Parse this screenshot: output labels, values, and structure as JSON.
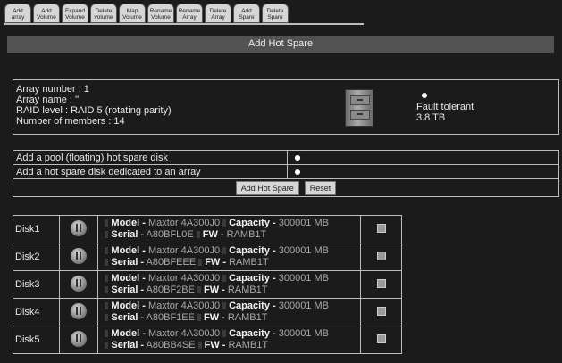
{
  "toolbar": {
    "tabs": [
      {
        "label": "Add\narray"
      },
      {
        "label": "Add\nVolume"
      },
      {
        "label": "Expand\nVolume"
      },
      {
        "label": "Delete\nvolume"
      },
      {
        "label": "Map\nVolume"
      },
      {
        "label": "Rename\nVolume"
      },
      {
        "label": "Rename\nArray"
      },
      {
        "label": "Delete\nArray"
      },
      {
        "label": "Add\nSpare"
      },
      {
        "label": "Delete\nSpare"
      }
    ]
  },
  "page": {
    "title": "Add Hot Spare"
  },
  "array": {
    "number": "Array number : 1",
    "name": "Array name : ''",
    "raid_level": "RAID level : RAID 5 (rotating parity)",
    "members": "Number of members : 14",
    "status": "Fault tolerant",
    "size": "3.8 TB",
    "icon": "file-cabinet-icon"
  },
  "options": {
    "pool_label": "Add a pool (floating) hot spare disk",
    "dedicated_label": "Add a hot spare disk dedicated to an array",
    "selected": "pool",
    "add_button": "Add Hot Spare",
    "reset_button": "Reset"
  },
  "disk_labels": {
    "model": "Model -",
    "capacity": "Capacity -",
    "serial": "Serial -",
    "fw": "FW -"
  },
  "disks": [
    {
      "name": "Disk1",
      "model": "Maxtor 4A300J0",
      "capacity": "300001 MB",
      "serial": "A80BFL0E",
      "fw": "RAMB1T"
    },
    {
      "name": "Disk2",
      "model": "Maxtor 4A300J0",
      "capacity": "300001 MB",
      "serial": "A80BFEEE",
      "fw": "RAMB1T"
    },
    {
      "name": "Disk3",
      "model": "Maxtor 4A300J0",
      "capacity": "300001 MB",
      "serial": "A80BF2BE",
      "fw": "RAMB1T"
    },
    {
      "name": "Disk4",
      "model": "Maxtor 4A300J0",
      "capacity": "300001 MB",
      "serial": "A80BF1EE",
      "fw": "RAMB1T"
    },
    {
      "name": "Disk5",
      "model": "Maxtor 4A300J0",
      "capacity": "300001 MB",
      "serial": "A80BB4SE",
      "fw": "RAMB1T"
    }
  ],
  "colors": {
    "background": "#1b1b1b",
    "title_bar": "#525252",
    "border": "#bdbdbd"
  }
}
